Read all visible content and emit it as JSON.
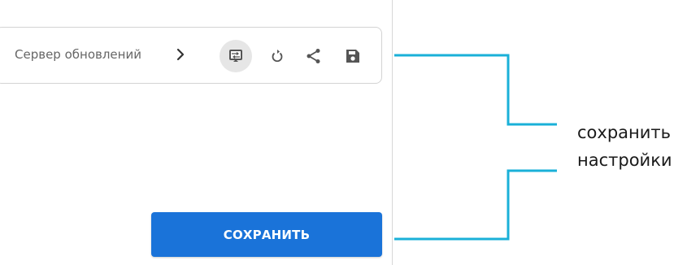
{
  "toolbar": {
    "breadcrumb_label": "Сервер обновлений",
    "icons": [
      "chevron-right-icon",
      "terminal-icon",
      "reload-icon",
      "share-icon",
      "save-icon"
    ]
  },
  "main": {
    "save_button_label": "СОХРАНИТЬ"
  },
  "callout": {
    "line1": "сохранить",
    "line2": "настройки",
    "color": "#1ab0d8"
  },
  "colors": {
    "button": "#1a73d9",
    "icon": "#555555",
    "active_icon_bg": "#e6e6e6"
  }
}
